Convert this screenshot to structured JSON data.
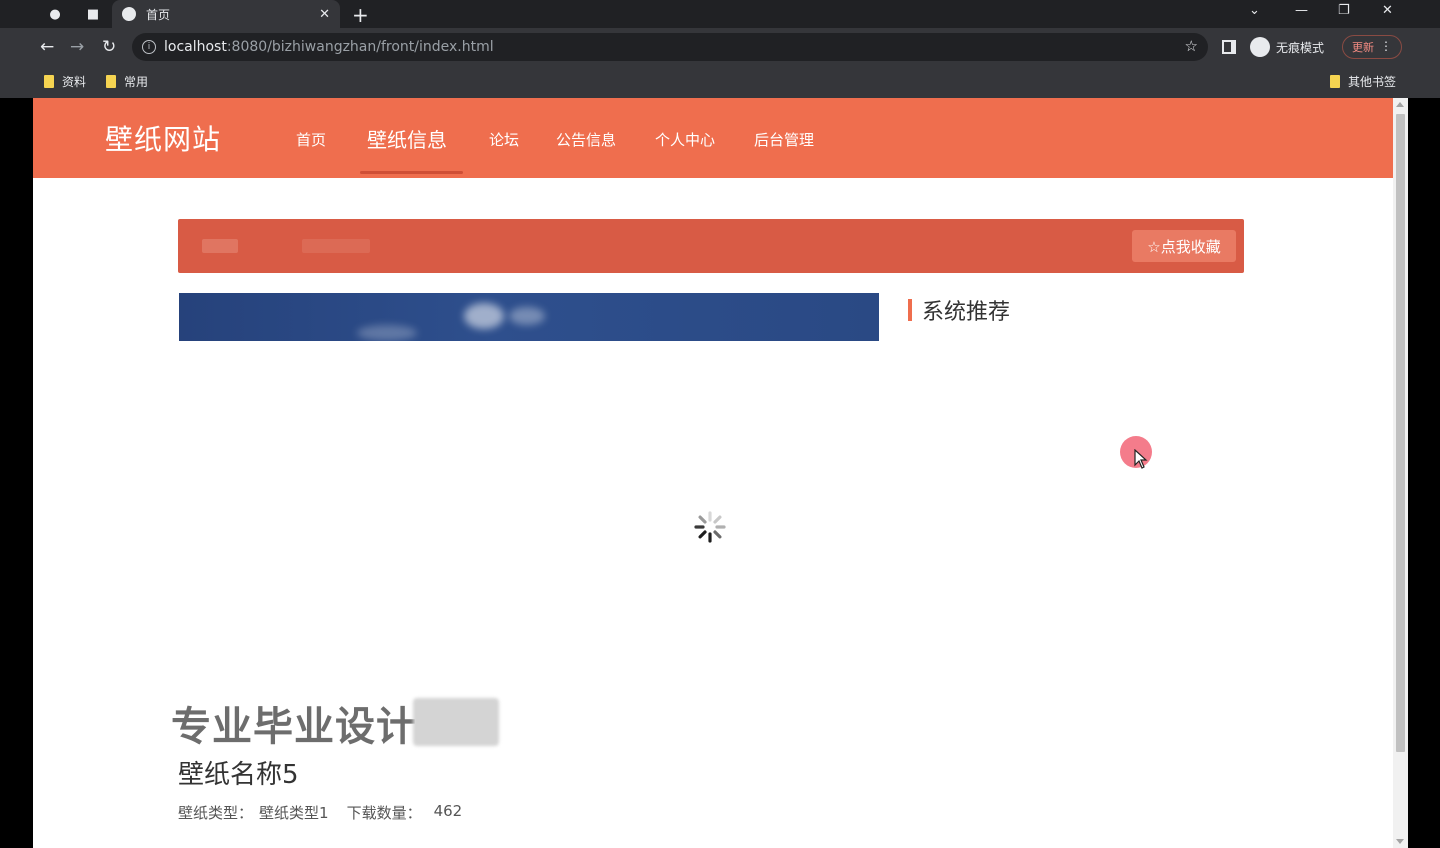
{
  "browser": {
    "tab_title": "首页",
    "url_host": "localhost",
    "url_rest": ":8080/bizhiwangzhan/front/index.html",
    "incognito_label": "无痕模式",
    "update_label": "更新",
    "bookmarks": [
      "资料",
      "常用"
    ],
    "other_bookmarks": "其他书签"
  },
  "site": {
    "logo": "壁纸网站",
    "nav": [
      "首页",
      "壁纸信息",
      "论坛",
      "公告信息",
      "个人中心",
      "后台管理"
    ],
    "active_nav_index": 1,
    "favorite_button": "☆点我收藏",
    "recommend_title": "系统推荐"
  },
  "overlay": {
    "watermark": "专业毕业设计"
  },
  "item": {
    "name": "壁纸名称5",
    "type_label": "壁纸类型：",
    "type_value": "壁纸类型1",
    "downloads_label": "下载数量：",
    "downloads_value": "462"
  },
  "colors": {
    "header": "#ef6e4e",
    "search_bar": "#d85b45",
    "accent": "#ef6e4e"
  }
}
